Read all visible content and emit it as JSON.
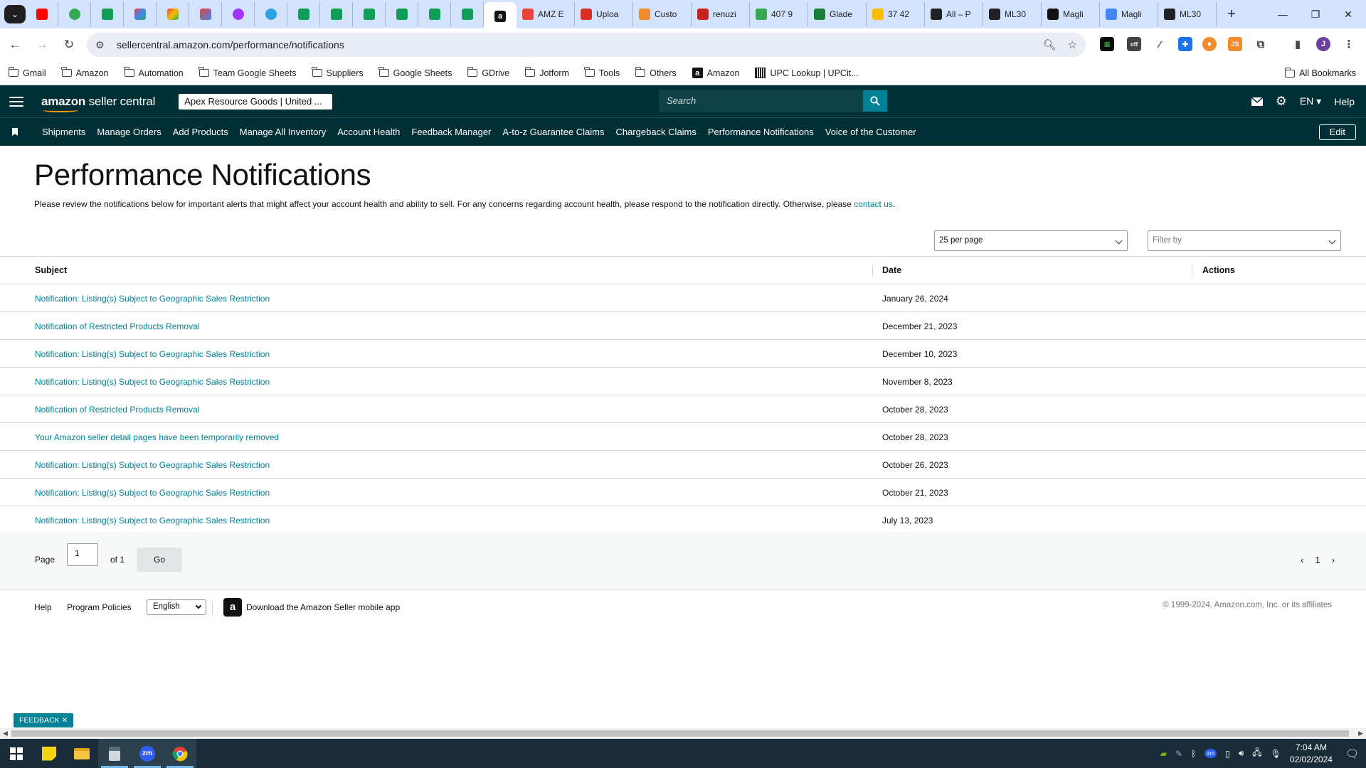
{
  "browser": {
    "active_tab_icon": "amazon-a-icon",
    "tabs": [
      {
        "title": "AMZ E",
        "icon": "rainbow-feather-icon",
        "color": "#ea4335"
      },
      {
        "title": "Uploa",
        "icon": "red-shield-icon",
        "color": "#d93025"
      },
      {
        "title": "Custo",
        "icon": "oc-logo-icon",
        "color": "#f28b2c"
      },
      {
        "title": "renuzi",
        "icon": "jk-red-icon",
        "color": "#c5221f"
      },
      {
        "title": "407 9",
        "icon": "pin-multicolor-icon",
        "color": "#34a853"
      },
      {
        "title": "Glade",
        "icon": "green-sheet-icon",
        "color": "#188038"
      },
      {
        "title": "37 42",
        "icon": "pin-multicolor-icon",
        "color": "#fbbc04"
      },
      {
        "title": "All – P",
        "icon": "black-helmet-icon",
        "color": "#202124"
      },
      {
        "title": "ML30",
        "icon": "black-helmet-icon",
        "color": "#202124"
      },
      {
        "title": "Magli",
        "icon": "amazon-a-icon",
        "color": "#111111"
      },
      {
        "title": "Magli",
        "icon": "google-g-icon",
        "color": "#4285f4"
      },
      {
        "title": "ML30",
        "icon": "black-helmet-icon",
        "color": "#202124"
      }
    ],
    "url": "sellercentral.amazon.com/performance/notifications",
    "bookmarks": [
      {
        "label": "Gmail",
        "type": "folder"
      },
      {
        "label": "Amazon",
        "type": "folder"
      },
      {
        "label": "Automation",
        "type": "folder"
      },
      {
        "label": "Team Google Sheets",
        "type": "folder"
      },
      {
        "label": "Suppliers",
        "type": "folder"
      },
      {
        "label": "Google Sheets",
        "type": "folder"
      },
      {
        "label": "GDrive",
        "type": "folder"
      },
      {
        "label": "Jotform",
        "type": "folder"
      },
      {
        "label": "Tools",
        "type": "folder"
      },
      {
        "label": "Others",
        "type": "folder"
      },
      {
        "label": "Amazon",
        "type": "amazon"
      },
      {
        "label": "UPC Lookup | UPCit...",
        "type": "upc"
      }
    ],
    "all_bookmarks": "All Bookmarks",
    "profile_initial": "J",
    "ext_off_badge": "off",
    "ext_js_label": "JS"
  },
  "header": {
    "logo_bold": "amazon",
    "logo_rest": " seller central",
    "account_name": "Apex Resource Goods",
    "account_region": "United ...",
    "search_placeholder": "Search",
    "language": "EN",
    "help": "Help",
    "nav_links": [
      "Shipments",
      "Manage Orders",
      "Add Products",
      "Manage All Inventory",
      "Account Health",
      "Feedback Manager",
      "A-to-z Guarantee Claims",
      "Chargeback Claims",
      "Performance Notifications",
      "Voice of the Customer"
    ],
    "edit_label": "Edit"
  },
  "page": {
    "title": "Performance Notifications",
    "description": "Please review the notifications below for important alerts that might affect your account health and ability to sell. For any concerns regarding account health, please respond to the notification directly. Otherwise, please ",
    "contact_link": "contact us",
    "description_end": ".",
    "per_page": "25 per page",
    "filter_placeholder": "Filter by",
    "columns": {
      "subject": "Subject",
      "date": "Date",
      "actions": "Actions"
    },
    "rows": [
      {
        "subject": "Notification: Listing(s) Subject to Geographic Sales Restriction",
        "date": "January 26, 2024"
      },
      {
        "subject": "Notification of Restricted Products Removal",
        "date": "December 21, 2023"
      },
      {
        "subject": "Notification: Listing(s) Subject to Geographic Sales Restriction",
        "date": "December 10, 2023"
      },
      {
        "subject": "Notification: Listing(s) Subject to Geographic Sales Restriction",
        "date": "November 8, 2023"
      },
      {
        "subject": "Notification of Restricted Products Removal",
        "date": "October 28, 2023"
      },
      {
        "subject": "Your Amazon seller detail pages have been temporarily removed",
        "date": "October 28, 2023"
      },
      {
        "subject": "Notification: Listing(s) Subject to Geographic Sales Restriction",
        "date": "October 26, 2023"
      },
      {
        "subject": "Notification: Listing(s) Subject to Geographic Sales Restriction",
        "date": "October 21, 2023"
      },
      {
        "subject": "Notification: Listing(s) Subject to Geographic Sales Restriction",
        "date": "July 13, 2023"
      }
    ],
    "pager": {
      "page_label": "Page",
      "page_value": "1",
      "of_label": "of 1",
      "go_label": "Go",
      "current_page": "1"
    }
  },
  "footer": {
    "help": "Help",
    "program_policies": "Program Policies",
    "language": "English",
    "app_text": "Download the Amazon Seller mobile app",
    "copyright": "© 1999-2024, Amazon.com, Inc. or its affiliates",
    "feedback": "FEEDBACK"
  },
  "taskbar": {
    "time": "7:04 AM",
    "date": "02/02/2024",
    "zoom_label": "zm",
    "amazon_letter": "a"
  },
  "colors": {
    "header_bg": "#002f36",
    "link": "#008296",
    "tab_strip": "#d3e3fd"
  }
}
